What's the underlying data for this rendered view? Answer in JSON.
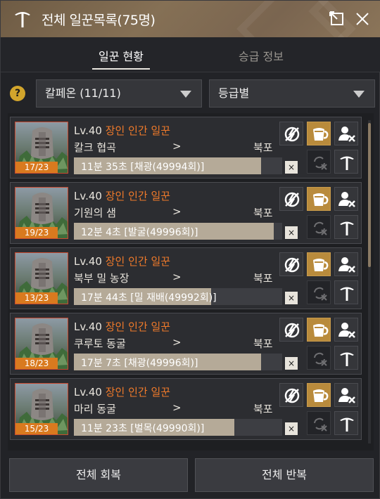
{
  "window": {
    "title": "전체 일꾼목록(75명)"
  },
  "tabs": [
    {
      "label": "일꾼 현황",
      "active": true
    },
    {
      "label": "승급 정보",
      "active": false
    }
  ],
  "filters": {
    "help_label": "?",
    "town": "칼페온 (11/11)",
    "sort": "등급별"
  },
  "workers": [
    {
      "level": "Lv.40",
      "grade": "장인 인간 일꾼",
      "location": "칼크 협곡",
      "arrow": ">",
      "destination": "북포",
      "stamina": "17/23",
      "progress_text": "11분 35초 [채광(49994회)]",
      "progress": 0.9,
      "cancel": "×"
    },
    {
      "level": "Lv.40",
      "grade": "장인 인간 일꾼",
      "location": "기원의 샘",
      "arrow": ">",
      "destination": "북포",
      "stamina": "19/23",
      "progress_text": "12분 4초 [발굴(49996회)]",
      "progress": 0.96,
      "cancel": "×"
    },
    {
      "level": "Lv.40",
      "grade": "장인 인간 일꾼",
      "location": "북부 밀 농장",
      "arrow": ">",
      "destination": "북포",
      "stamina": "13/23",
      "progress_text": "17분 44초 [밀 재배(49992회)]",
      "progress": 0.66,
      "cancel": "×"
    },
    {
      "level": "Lv.40",
      "grade": "장인 인간 일꾼",
      "location": "쿠루토 동굴",
      "arrow": ">",
      "destination": "북포",
      "stamina": "18/23",
      "progress_text": "17분 7초 [채광(49996회)]",
      "progress": 0.9,
      "cancel": "×"
    },
    {
      "level": "Lv.40",
      "grade": "장인 인간 일꾼",
      "location": "마리 동굴",
      "arrow": ">",
      "destination": "북포",
      "stamina": "15/23",
      "progress_text": "11분 23초 [벌목(49990회)]",
      "progress": 0.77,
      "cancel": "×"
    }
  ],
  "footer": {
    "recover_all": "전체 회복",
    "repeat_all": "전체 반복"
  },
  "colors": {
    "accent_orange": "#f07a2a",
    "gold_button": "#b98b3c",
    "title_bar": "#857055",
    "help_icon": "#d2a52c"
  },
  "icons": [
    "pickaxe-icon",
    "popout-icon",
    "close-icon",
    "help-icon",
    "no-stamina-icon",
    "beer-icon",
    "dismiss-worker-icon",
    "repeat-icon",
    "pickaxe-icon"
  ]
}
